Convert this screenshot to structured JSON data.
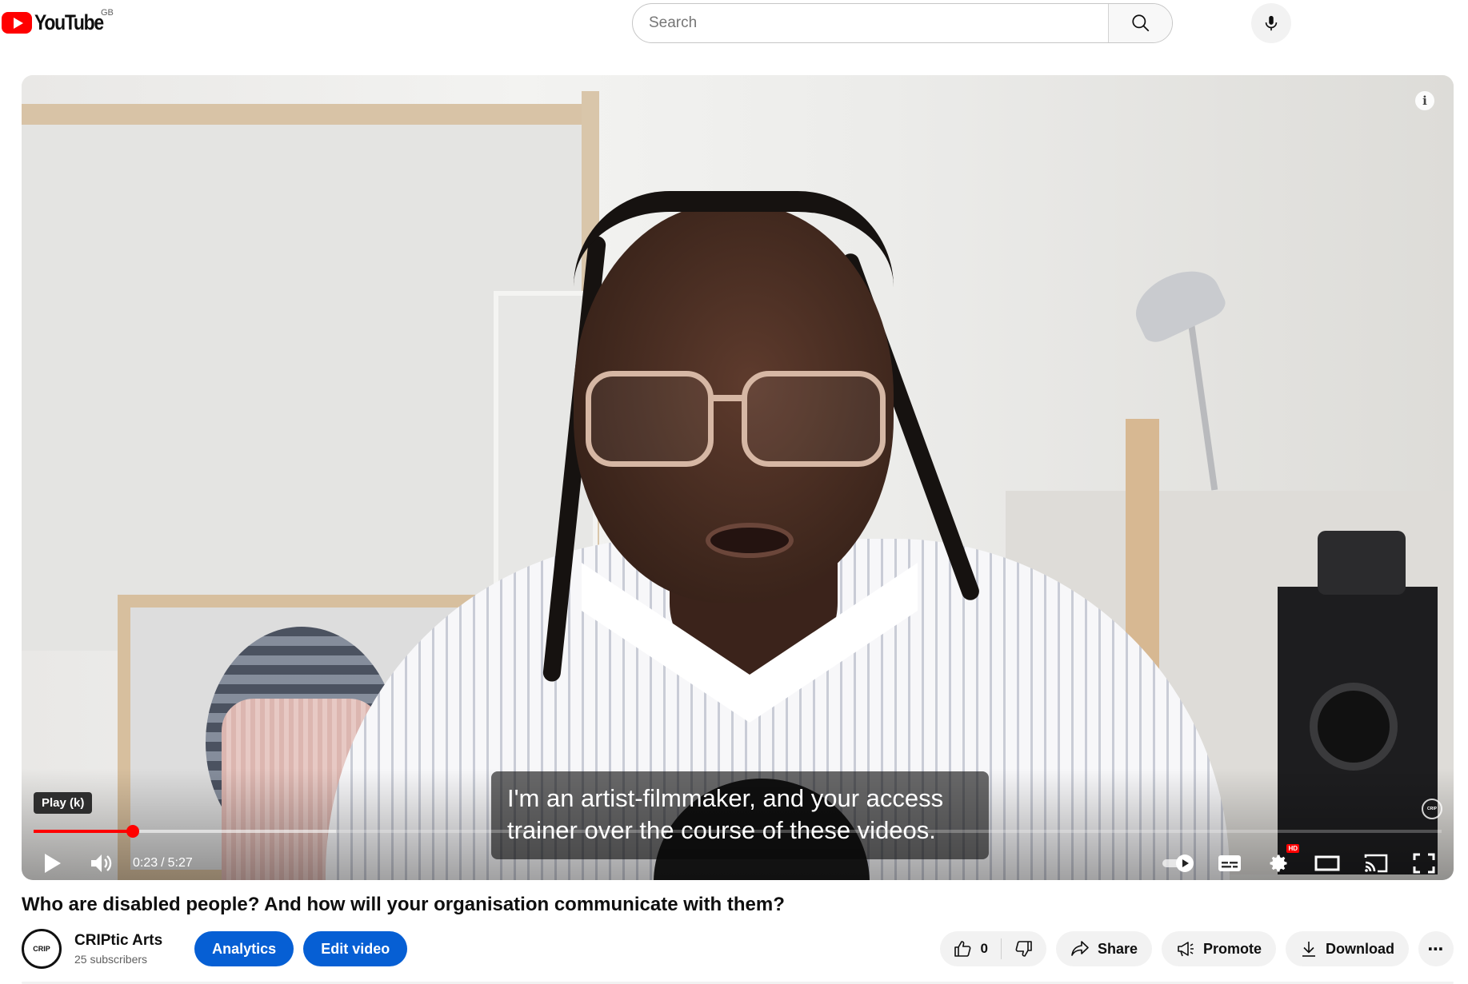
{
  "header": {
    "logo_text": "YouTube",
    "country_code": "GB",
    "search_placeholder": "Search"
  },
  "player": {
    "caption_lines": [
      "I'm an artist-filmmaker, and your access",
      "trainer over the course of these videos."
    ],
    "tooltip": "Play (k)",
    "current_time": "0:23",
    "time_separator": "/",
    "duration": "5:27",
    "progress_fraction": 0.0703,
    "buffered_fraction": 0.215,
    "hd_badge": "HD",
    "info_icon_glyph": "i",
    "watermark_text": "CRIP",
    "accent_color": "#ff0000"
  },
  "video": {
    "title": "Who are disabled people? And how will your organisation communicate with them?"
  },
  "channel": {
    "avatar_text": "CRIP",
    "name": "CRIPtic Arts",
    "subscribers": "25 subscribers"
  },
  "owner_buttons": {
    "analytics": "Analytics",
    "edit_video": "Edit video",
    "color": "#065fd4"
  },
  "actions": {
    "like_count": "0",
    "share": "Share",
    "promote": "Promote",
    "download": "Download",
    "more": "⋯"
  },
  "icons": {
    "logo": "youtube-logo-icon",
    "search": "search-icon",
    "mic": "mic-icon",
    "play": "play-icon",
    "volume": "volume-icon",
    "autoplay": "autoplay-toggle-icon",
    "subtitles": "subtitles-icon",
    "settings": "settings-icon",
    "theater": "theater-mode-icon",
    "cast": "cast-icon",
    "fullscreen": "fullscreen-icon",
    "like": "thumbs-up-icon",
    "dislike": "thumbs-down-icon",
    "share": "share-icon",
    "promote": "megaphone-icon",
    "download": "download-icon"
  }
}
